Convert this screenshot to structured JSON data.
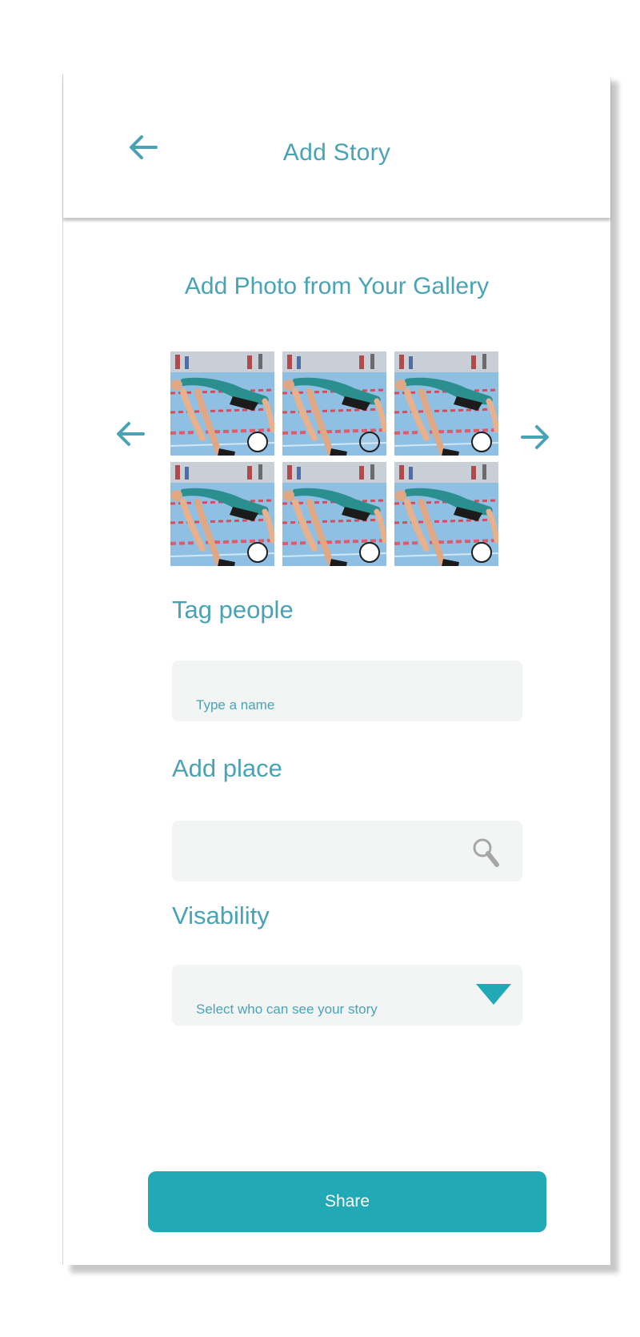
{
  "header": {
    "title": "Add Story",
    "back_icon": "left-arrow-icon"
  },
  "gallery": {
    "title": "Add Photo from Your Gallery",
    "prev_icon": "left-arrow-icon",
    "next_icon": "right-arrow-icon",
    "photos": [
      {
        "subject": "swimmer diving photo",
        "selected": false
      },
      {
        "subject": "swimmer diving photo",
        "selected": false
      },
      {
        "subject": "swimmer diving photo",
        "selected": false
      },
      {
        "subject": "swimmer diving photo",
        "selected": false
      },
      {
        "subject": "swimmer diving photo",
        "selected": false
      },
      {
        "subject": "swimmer diving photo",
        "selected": false
      }
    ]
  },
  "tag_people": {
    "label": "Tag people",
    "placeholder": "Type a name"
  },
  "add_place": {
    "label": "Add place",
    "placeholder": "",
    "icon": "search-icon"
  },
  "visibility": {
    "label": "Visability",
    "placeholder": "Select who can see your story",
    "icon": "dropdown-triangle-icon"
  },
  "share": {
    "label": "Share"
  },
  "colors": {
    "accent": "#4aa3b4",
    "button": "#22a9b6",
    "field_bg": "#f3f5f5"
  }
}
